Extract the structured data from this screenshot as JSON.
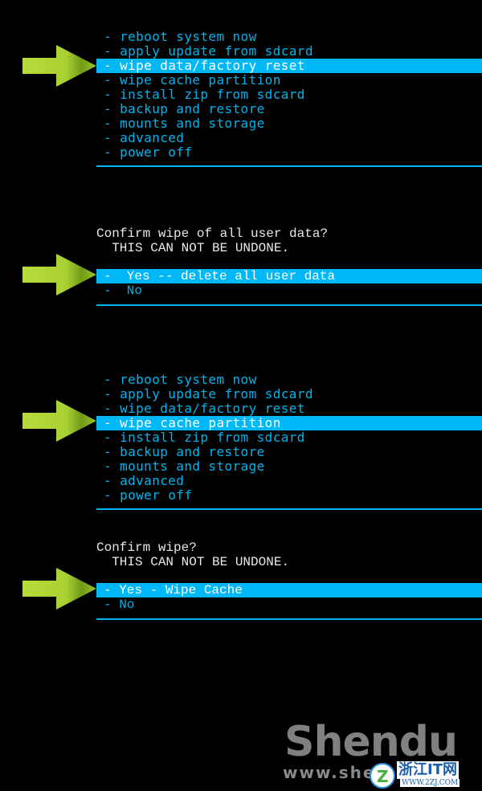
{
  "colors": {
    "background": "#000000",
    "menu_text": "#00b4f0",
    "highlight": "#00b8f8",
    "highlight_text": "#ffffff",
    "prompt_text": "#e8e8e8",
    "arrow": "#a8d030"
  },
  "panels": [
    {
      "type": "menu",
      "items": [
        "- reboot system now",
        "- apply update from sdcard",
        "- wipe data/factory reset",
        "- wipe cache partition",
        "- install zip from sdcard",
        "- backup and restore",
        "- mounts and storage",
        "- advanced",
        "- power off"
      ],
      "selected_index": 2
    },
    {
      "type": "confirm",
      "prompt_line1": "Confirm wipe of all user data?",
      "prompt_line2": "  THIS CAN NOT BE UNDONE.",
      "options": [
        "-  Yes -- delete all user data",
        "-  No"
      ],
      "selected_index": 0
    },
    {
      "type": "menu",
      "items": [
        "- reboot system now",
        "- apply update from sdcard",
        "- wipe data/factory reset",
        "- wipe cache partition",
        "- install zip from sdcard",
        "- backup and restore",
        "- mounts and storage",
        "- advanced",
        "- power off"
      ],
      "selected_index": 3
    },
    {
      "type": "confirm",
      "prompt_line1": "Confirm wipe?",
      "prompt_line2": "  THIS CAN NOT BE UNDONE.",
      "options": [
        "- Yes - Wipe Cache",
        "- No"
      ],
      "selected_index": 0
    }
  ],
  "watermark": {
    "logo": "Shendu",
    "url": "www.she",
    "badge_title": "浙江IT网",
    "badge_sub": "WWW.2ZJ.COM",
    "badge_glyph": "Z"
  }
}
